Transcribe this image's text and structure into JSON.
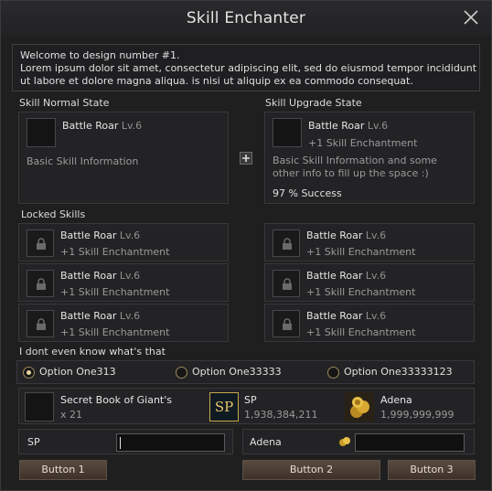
{
  "window": {
    "title": "Skill Enchanter"
  },
  "intro": {
    "line1": "Welcome to design number #1.",
    "line2": "Lorem ipsum dolor sit amet, consectetur adipiscing elit, sed do eiusmod tempor incididunt ut labore et dolore magna aliqua. is nisi ut aliquip ex ea commodo consequat."
  },
  "normal_state": {
    "title": "Skill Normal State",
    "skill_name": "Battle Roar",
    "skill_level": "Lv.6",
    "info": "Basic Skill Information"
  },
  "upgrade_state": {
    "title": "Skill Upgrade State",
    "skill_name": "Battle Roar",
    "skill_level": "Lv.6",
    "enchant": "+1 Skill Enchantment",
    "info": "Basic Skill Information and some other info to fill up the space :)",
    "success": "97 % Success"
  },
  "locked": {
    "title": "Locked Skills",
    "items": [
      {
        "name": "Battle Roar",
        "level": "Lv.6",
        "enchant": "+1 Skill Enchantment"
      },
      {
        "name": "Battle Roar",
        "level": "Lv.6",
        "enchant": "+1 Skill Enchantment"
      },
      {
        "name": "Battle Roar",
        "level": "Lv.6",
        "enchant": "+1 Skill Enchantment"
      },
      {
        "name": "Battle Roar",
        "level": "Lv.6",
        "enchant": "+1 Skill Enchantment"
      },
      {
        "name": "Battle Roar",
        "level": "Lv.6",
        "enchant": "+1 Skill Enchantment"
      },
      {
        "name": "Battle Roar",
        "level": "Lv.6",
        "enchant": "+1 Skill Enchantment"
      }
    ]
  },
  "options": {
    "title": "I dont even know what's that",
    "items": [
      "Option One313",
      "Option One33333",
      "Option One33333123"
    ],
    "selected_index": 0
  },
  "requirements": {
    "book": {
      "name": "Secret Book of Giant's",
      "count": "x 21"
    },
    "sp": {
      "label": "SP",
      "value": "1,938,384,211",
      "icon_text": "SP"
    },
    "adena": {
      "label": "Adena",
      "value": "1,999,999,999"
    }
  },
  "inputs": {
    "sp_label": "SP",
    "sp_value": "",
    "adena_label": "Adena",
    "adena_value": ""
  },
  "buttons": {
    "button1": "Button 1",
    "button2": "Button 2",
    "button3": "Button 3"
  },
  "colors": {
    "accent_gold": "#c8a84a",
    "button_brown": "#4a3c32"
  }
}
